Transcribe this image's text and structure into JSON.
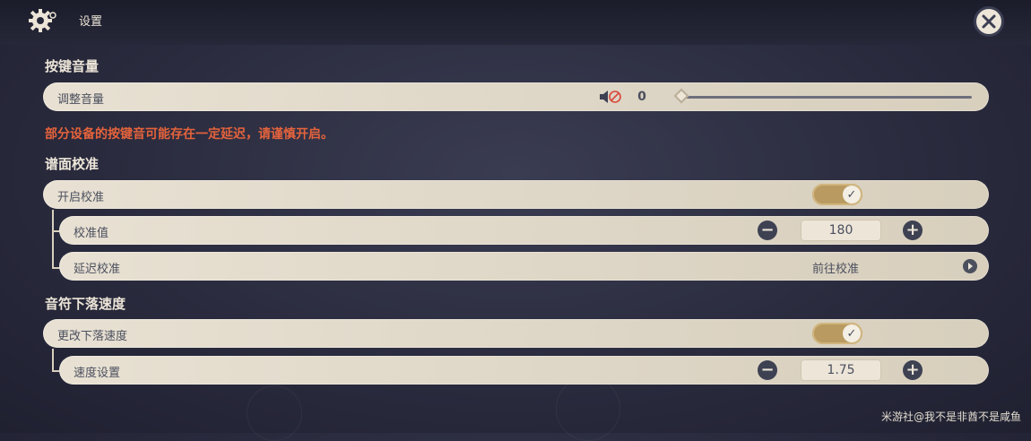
{
  "header": {
    "title": "设置"
  },
  "sections": {
    "key_volume": {
      "title": "按键音量"
    },
    "calibration": {
      "title": "谱面校准"
    },
    "fall_speed": {
      "title": "音符下落速度"
    }
  },
  "volume": {
    "label": "调整音量",
    "value": "0",
    "level": 0
  },
  "warning_text": "部分设备的按键音可能存在一定延迟，请谨慎开启。",
  "calibration": {
    "enable_label": "开启校准",
    "enable_on": true,
    "value_label": "校准值",
    "value": "180",
    "delay_label": "延迟校准",
    "goto_label": "前往校准"
  },
  "fall_speed": {
    "change_label": "更改下落速度",
    "change_on": true,
    "speed_label": "速度设置",
    "speed_value": "1.75"
  },
  "watermark": "米游社@我不是非酋不是咸鱼",
  "icons": {
    "gear": "gear-icon",
    "close": "close-icon",
    "volume_muted": "volume-muted-icon",
    "check": "check-icon",
    "minus": "minus-icon",
    "plus": "plus-icon",
    "arrow": "arrow-right-icon"
  },
  "colors": {
    "accent_gold": "#b99b62",
    "warning_red": "#e5633c",
    "row_bg": "#e8e1d3"
  }
}
